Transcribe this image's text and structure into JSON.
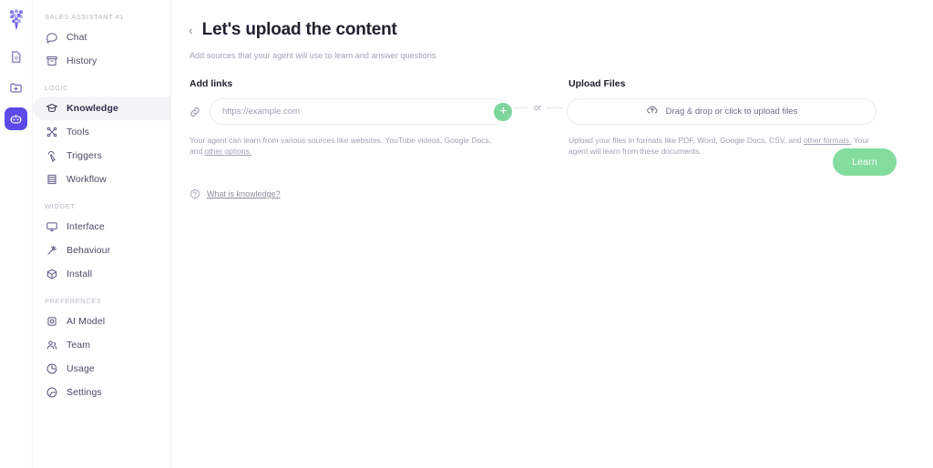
{
  "rail": {
    "logo_name": "grape-logo",
    "items": [
      {
        "name": "design-file-icon",
        "active": false
      },
      {
        "name": "folder-add-icon",
        "active": false
      },
      {
        "name": "agent-robot-icon",
        "active": true
      }
    ]
  },
  "sidebar": {
    "sections": [
      {
        "title": "SALES ASSISTANT #1",
        "items": [
          {
            "label": "Chat",
            "icon": "chat-bubble-icon",
            "active": false
          },
          {
            "label": "History",
            "icon": "archive-box-icon",
            "active": false
          }
        ]
      },
      {
        "title": "LOGIC",
        "items": [
          {
            "label": "Knowledge",
            "icon": "graduation-cap-icon",
            "active": true
          },
          {
            "label": "Tools",
            "icon": "scissors-icon",
            "active": false
          },
          {
            "label": "Triggers",
            "icon": "cursor-click-icon",
            "active": false
          },
          {
            "label": "Workflow",
            "icon": "layers-icon",
            "active": false
          }
        ]
      },
      {
        "title": "WIDGET",
        "items": [
          {
            "label": "Interface",
            "icon": "monitor-icon",
            "active": false
          },
          {
            "label": "Behaviour",
            "icon": "sparkle-wand-icon",
            "active": false
          },
          {
            "label": "Install",
            "icon": "cube-icon",
            "active": false
          }
        ]
      },
      {
        "title": "PREFERENCES",
        "items": [
          {
            "label": "AI Model",
            "icon": "chip-icon",
            "active": false
          },
          {
            "label": "Team",
            "icon": "users-icon",
            "active": false
          },
          {
            "label": "Usage",
            "icon": "pie-chart-icon",
            "active": false
          },
          {
            "label": "Settings",
            "icon": "gear-circle-icon",
            "active": false
          }
        ]
      }
    ]
  },
  "header": {
    "back_chevron": "‹",
    "title": "Let's upload the content",
    "subtitle": "Add sources that your agent will use to learn and answer questions"
  },
  "add_links": {
    "label": "Add links",
    "link_icon": "chain-link-icon",
    "input_value": "",
    "input_placeholder": "https://example.com",
    "add_button_icon": "plus-icon",
    "helper_text": "Your agent can learn from various sources like websites, YouTube videos, Google Docs, and ",
    "helper_link": "other options."
  },
  "separator": {
    "text": "or"
  },
  "upload_files": {
    "label": "Upload Files",
    "dropzone_icon": "cloud-upload-icon",
    "dropzone_text": "Drag & drop or click to upload files",
    "helper_text_before": "Upload your files in formats like PDF, Word, Google Docs, CSV, and ",
    "helper_link": "other formats.",
    "helper_text_after": " Your agent will learn from these documents."
  },
  "footer": {
    "knowledge_icon": "question-circle-icon",
    "knowledge_link": "What is knowledge?",
    "learn_button": "Learn"
  },
  "colors": {
    "accent_purple": "#5b4ae8",
    "accent_green": "#84dd9f",
    "text_dark": "#22202f",
    "text_muted": "#a3a1b4",
    "nav_text": "#4c4866"
  }
}
